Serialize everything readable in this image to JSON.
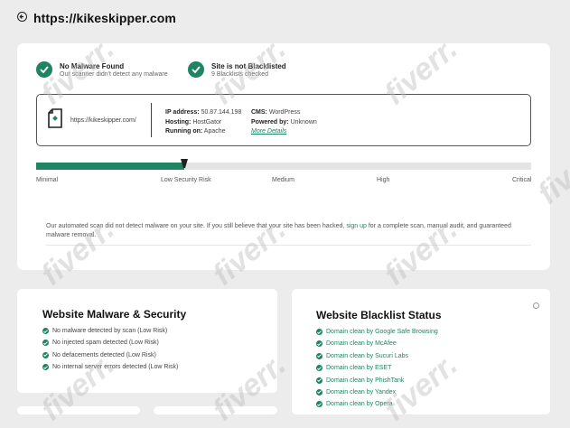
{
  "header": {
    "title": "https://kikeskipper.com"
  },
  "summary": {
    "malware": {
      "title": "No Malware Found",
      "subtitle": "Our scanner didn't detect any malware"
    },
    "blacklist": {
      "title": "Site is not Blacklisted",
      "subtitle": "9 Blacklists checked"
    }
  },
  "site_info": {
    "url": "https://kikeskipper.com/",
    "ip_label": "IP address:",
    "ip_value": "50.87.144.198",
    "hosting_label": "Hosting:",
    "hosting_value": "HostGator",
    "running_label": "Running on:",
    "running_value": "Apache",
    "cms_label": "CMS:",
    "cms_value": "WordPress",
    "powered_label": "Powered by:",
    "powered_value": "Unknown",
    "more_details": "More Details"
  },
  "risk": {
    "level_fraction": 0.3,
    "labels": [
      "Minimal",
      "Low Security Risk",
      "Medium",
      "High",
      "Critical"
    ],
    "color": "#1e8463"
  },
  "notice": {
    "text_before": "Our automated scan did not detect malware on your site. If you still believe that your site has been hacked,",
    "link": "sign up",
    "text_after": "for a complete scan, manual audit, and guaranteed malware removal."
  },
  "malware_card": {
    "title": "Website Malware & Security",
    "items": [
      "No malware detected by scan (Low Risk)",
      "No injected spam detected (Low Risk)",
      "No defacements detected (Low Risk)",
      "No internal server errors detected (Low Risk)"
    ]
  },
  "blacklist_card": {
    "title": "Website Blacklist Status",
    "items": [
      "Domain clean by Google Safe Browsing",
      "Domain clean by McAfee",
      "Domain clean by Sucuri Labs",
      "Domain clean by ESET",
      "Domain clean by PhishTank",
      "Domain clean by Yandex",
      "Domain clean by Opera"
    ]
  },
  "watermark": "fiverr."
}
